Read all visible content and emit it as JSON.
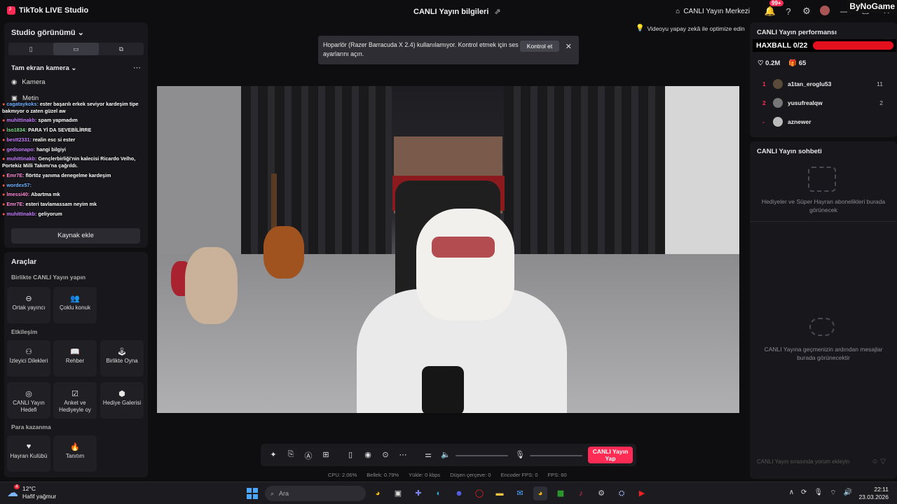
{
  "titlebar": {
    "app_title": "TikTok LIVE Studio",
    "center_title": "CANLI Yayın bilgileri",
    "live_center": "CANLI Yayın Merkezi",
    "notif_badge": "99+",
    "watermark": "ByNoGame"
  },
  "left": {
    "studio_view": "Studio görünümü",
    "scene_name": "Tam ekran kamera",
    "sources": [
      "Kamera",
      "Metin"
    ],
    "chat_overlay": [
      {
        "user": "cagataykoks:",
        "msg": "ester başarılı erkek seviyor kardeşim tipe bakmıyor o zaten güzel aw",
        "color": "#6fb0ff"
      },
      {
        "user": "muhittinakb:",
        "msg": "spam yapmadım",
        "color": "#c77dff"
      },
      {
        "user": "lso1834:",
        "msg": "PARA Yİ DA SEVEBİLİRRE",
        "color": "#7ee08a"
      },
      {
        "user": "bestt2331:",
        "msg": "realin esc si ester",
        "color": "#c77dff"
      },
      {
        "user": "gedsonapo:",
        "msg": "hangi bilgiyi",
        "color": "#c77dff"
      },
      {
        "user": "muhittinakb:",
        "msg": "Gençlerbirliği'nin kalecisi Ricardo Velho, Portekiz Milli Takımı'na çağrıldı.",
        "color": "#c77dff"
      },
      {
        "user": "Emr7E:",
        "msg": "flörtöz yanıma denegelme kardeşim",
        "color": "#ff8ad8"
      },
      {
        "user": "wordex57:",
        "msg": "",
        "color": "#6fb0ff"
      },
      {
        "user": "lmessi40:",
        "msg": "Abartma mk",
        "color": "#ff8ad8"
      },
      {
        "user": "Emr7E:",
        "msg": "esteri tavlamassam neyim mk",
        "color": "#ff8ad8"
      },
      {
        "user": "muhittinakb:",
        "msg": "geliyorum",
        "color": "#c77dff"
      }
    ],
    "add_source": "Kaynak ekle",
    "tools_title": "Araçlar",
    "sections": {
      "coop": "Birlikte CANLI Yayın yapın",
      "interaction": "Etkileşim",
      "earn": "Para kazanma"
    },
    "tools": {
      "cohost": "Ortak yayıncı",
      "multi_guest": "Çoklu konuk",
      "viewer_requests": "İzleyici Dilekleri",
      "guide": "Rehber",
      "play_together": "Birlikte Oyna",
      "live_goal": "CANLI Yayın Hedefi",
      "poll": "Anket ve Hediyeyle oy",
      "gift_gallery": "Hediye Galerisi",
      "fan_club": "Hayran Kulübü",
      "promote": "Tanıtım"
    }
  },
  "center": {
    "notice_text": "Hoparlör (Razer Barracuda X 2.4) kullanılamıyor. Kontrol etmek için ses ayarlarını açın.",
    "notice_button": "Kontrol et",
    "ai_optimize": "Videoyu yapay zekâ ile optimize edin",
    "go_live": "CANLI Yayın Yap",
    "stats": [
      "CPU: 2.06%",
      "Bellek: 0.79%",
      "Yükle: 0 kbps",
      "Düşen çerçeve: 0",
      "Encoder FPS: 0",
      "FPS: 60"
    ]
  },
  "right": {
    "perf_title": "CANLI Yayın performansı",
    "haxball": "HAXBALL 0/22",
    "haxball_progress": 1.0,
    "likes": "0.2M",
    "gifts": "65",
    "leaderboard": [
      {
        "rank": "1",
        "name": "a1tan_eroglu53",
        "score": "11",
        "avatar": "#5a4a3a"
      },
      {
        "rank": "2",
        "name": "yusufrealqw",
        "score": "2",
        "avatar": "#777"
      },
      {
        "rank": "-",
        "name": "aznewer",
        "score": "",
        "avatar": "#bbb"
      }
    ],
    "chat_title": "CANLI Yayın sohbeti",
    "gifts_empty": "Hediyeler ve Süper Hayran abonelikleri burada görünecek",
    "chat_empty": "CANLI Yayına geçmenizin ardından mesajlar burada görünecektir",
    "chat_placeholder": "CANLI Yayın sırasında yorum ekleyin"
  },
  "taskbar": {
    "temp": "12°C",
    "weather": "Hafif yağmur",
    "weather_badge": "4",
    "search": "Ara",
    "time": "22:11",
    "date": "23.03.2026"
  },
  "colors": {
    "accent": "#fe2c55",
    "panel": "#18181c",
    "background": "#0e0e10"
  }
}
